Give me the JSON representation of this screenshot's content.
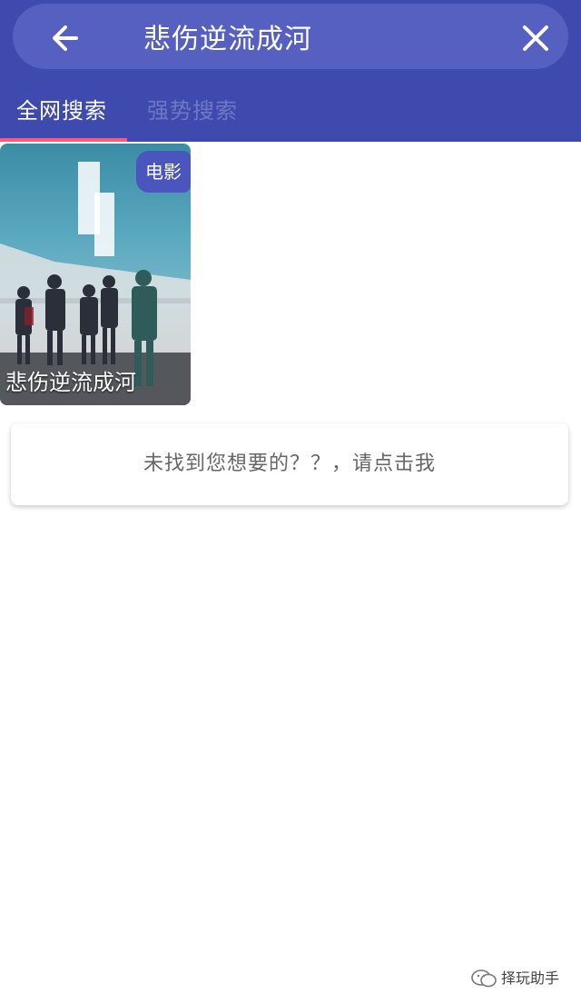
{
  "header": {
    "search_query": "悲伤逆流成河",
    "back_icon": "arrow-left-icon",
    "clear_icon": "close-icon",
    "background_color": "#3f4aae",
    "searchbar_color": "#5660c0"
  },
  "tabs": [
    {
      "label": "全网搜索",
      "active": true
    },
    {
      "label": "强势搜索",
      "active": false
    }
  ],
  "tab_indicator_color": "#ff5a7a",
  "results": [
    {
      "title": "悲伤逆流成河",
      "badge": "电影"
    }
  ],
  "not_found": {
    "text": "未找到您想要的？？，请点击我"
  },
  "watermark": {
    "text": "择玩助手"
  }
}
